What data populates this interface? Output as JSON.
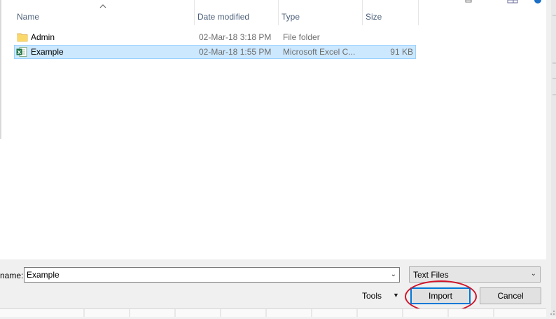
{
  "columns": {
    "name": "Name",
    "date_modified": "Date modified",
    "type": "Type",
    "size": "Size"
  },
  "files": [
    {
      "name": "Admin",
      "date": "02-Mar-18 3:18 PM",
      "type": "File folder",
      "size": "",
      "icon": "folder-icon",
      "selected": false
    },
    {
      "name": "Example",
      "date": "02-Mar-18 1:55 PM",
      "type": "Microsoft Excel C...",
      "size": "91 KB",
      "icon": "excel-file-icon",
      "selected": true
    }
  ],
  "filename": {
    "label": "name:",
    "value": "Example"
  },
  "file_type": {
    "selected": "Text Files"
  },
  "tools_label": "Tools",
  "buttons": {
    "import": "Import",
    "cancel": "Cancel"
  },
  "annotation": {
    "highlight_color": "#d0152a"
  }
}
